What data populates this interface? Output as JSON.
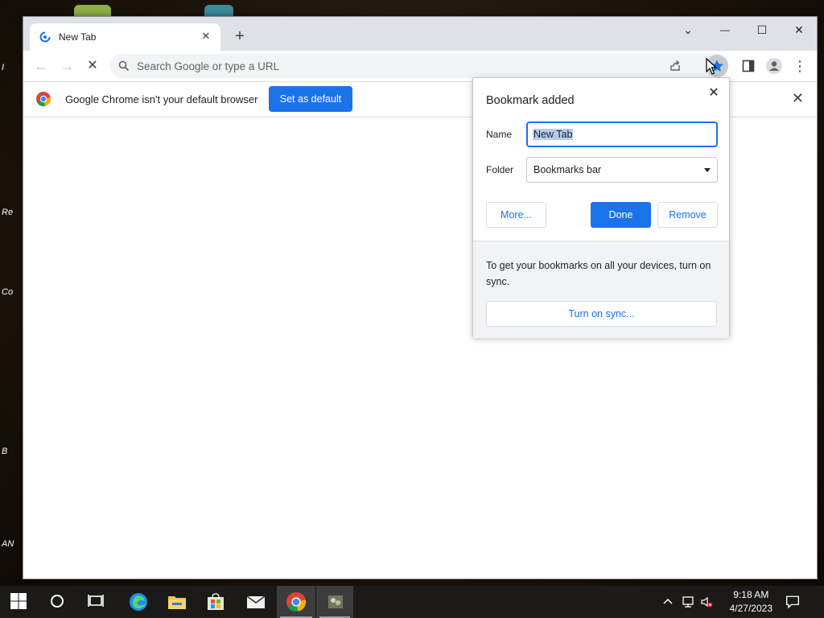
{
  "desktop": {
    "side_labels": [
      "I",
      "Re",
      "Co",
      "B",
      "AN"
    ]
  },
  "browser": {
    "tab": {
      "title": "New Tab",
      "favicon": "chrome-loading-icon",
      "close": "✕"
    },
    "new_tab": "+",
    "window_controls": {
      "tab_search": "⌄",
      "minimize": "—",
      "maximize": "☐",
      "close": "✕"
    },
    "toolbar": {
      "back": "←",
      "forward": "→",
      "stop": "✕",
      "omnibox_placeholder": "Search Google or type a URL",
      "menu": "⋮"
    },
    "infobar": {
      "message": "Google Chrome isn't your default browser",
      "button": "Set as default",
      "close": "✕"
    }
  },
  "bookmark_bubble": {
    "title": "Bookmark added",
    "close": "✕",
    "name_label": "Name",
    "name_value": "New Tab",
    "folder_label": "Folder",
    "folder_value": "Bookmarks bar",
    "more_button": "More...",
    "done_button": "Done",
    "remove_button": "Remove",
    "sync_message": "To get your bookmarks on all your devices, turn on sync.",
    "sync_button": "Turn on sync..."
  },
  "taskbar": {
    "apps": [
      "start",
      "search",
      "task-view",
      "edge",
      "file-explorer",
      "store",
      "mail",
      "chrome",
      "app"
    ],
    "active_app": "chrome",
    "time": "9:18 AM",
    "date": "4/27/2023",
    "colors": {
      "accent": "#1a73e8",
      "taskbar": "#1b1a18"
    }
  }
}
